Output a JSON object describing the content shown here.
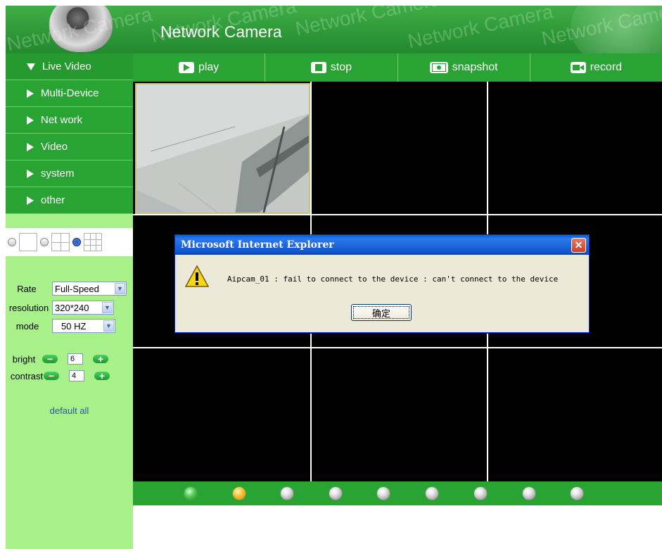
{
  "header": {
    "title": "Network Camera",
    "watermark": "Network Camera"
  },
  "sidebar": {
    "items": [
      {
        "label": "Live Video",
        "expanded": true
      },
      {
        "label": "Multi-Device",
        "expanded": false
      },
      {
        "label": "Net work",
        "expanded": false
      },
      {
        "label": "Video",
        "expanded": false
      },
      {
        "label": "system",
        "expanded": false
      },
      {
        "label": "other",
        "expanded": false
      }
    ],
    "layout_options": [
      "1-view",
      "4-view",
      "9-view"
    ],
    "layout_selected": "9-view",
    "controls": {
      "rate_label": "Rate",
      "rate_value": "Full-Speed",
      "resolution_label": "resolution",
      "resolution_value": "320*240",
      "mode_label": "mode",
      "mode_value": "50 HZ",
      "bright_label": "bright",
      "bright_value": "6",
      "contrast_label": "contrast",
      "contrast_value": "4",
      "minus_symbol": "−",
      "plus_symbol": "+"
    },
    "default_all": "default all"
  },
  "toolbar": {
    "play": "play",
    "stop": "stop",
    "snapshot": "snapshot",
    "record": "record"
  },
  "channels": {
    "count": 9,
    "states": [
      "active",
      "warning",
      "idle",
      "idle",
      "idle",
      "idle",
      "idle",
      "idle",
      "idle"
    ]
  },
  "dialog": {
    "title": "Microsoft Internet Explorer",
    "message": "Aipcam_01 : fail to connect to the device : can't connect to the device",
    "ok_label": "确定",
    "close_symbol": "✕"
  },
  "colors": {
    "brand_green": "#2aa335",
    "sidebar_bg": "#a8f08a",
    "link_blue": "#2a55b0"
  }
}
